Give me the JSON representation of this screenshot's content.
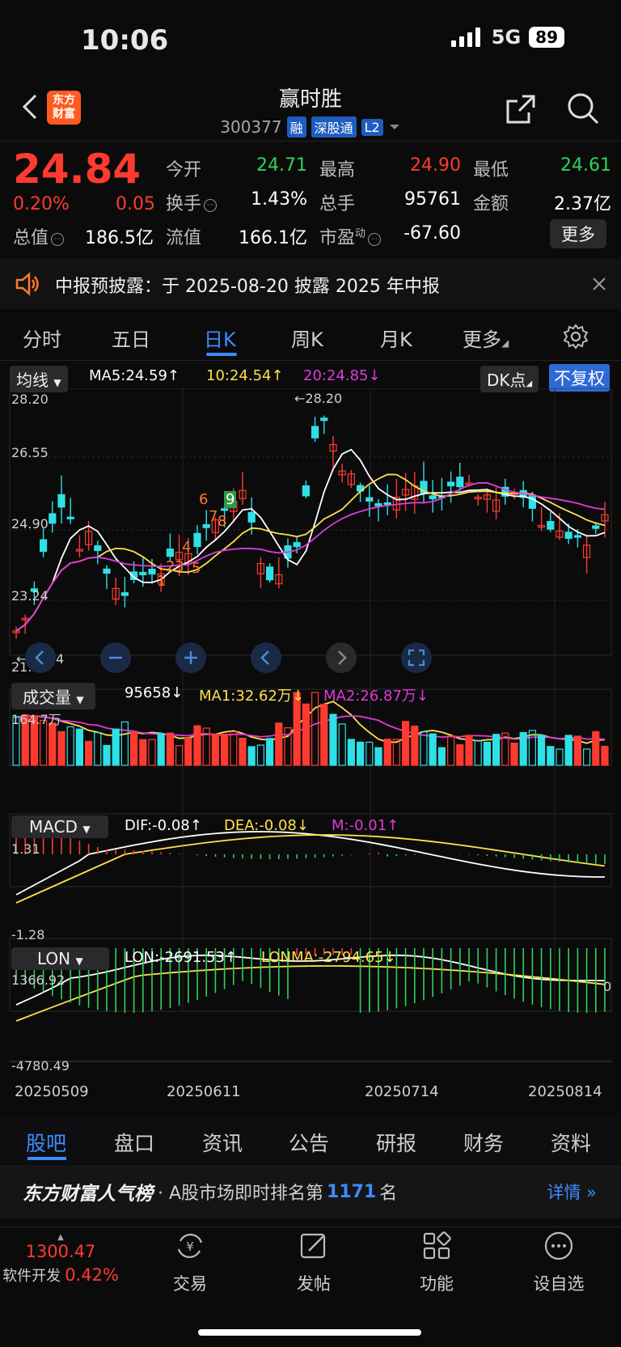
{
  "status": {
    "time": "10:06",
    "network": "5G",
    "battery": "89"
  },
  "header": {
    "brand_line1": "东方",
    "brand_line2": "财富",
    "title": "赢时胜",
    "code": "300377",
    "tags": [
      "融",
      "深股通",
      "L2"
    ]
  },
  "quote": {
    "price": "24.84",
    "chg_pct": "0.20%",
    "chg_val": "0.05",
    "rows": [
      [
        {
          "label": "今开",
          "value": "24.71",
          "color": "green"
        },
        {
          "label": "最高",
          "value": "24.90",
          "color": "red"
        },
        {
          "label": "最低",
          "value": "24.61",
          "color": "green"
        }
      ],
      [
        {
          "label": "换手",
          "value": "1.43%",
          "color": "white"
        },
        {
          "label": "总手",
          "value": "95761",
          "color": "white"
        },
        {
          "label": "金额",
          "value": "2.37亿",
          "color": "white"
        }
      ],
      [
        {
          "label": "总值",
          "value": "186.5亿"
        },
        {
          "label": "流值",
          "value": "166.1亿"
        },
        {
          "label": "市盈",
          "sup": "动",
          "value": "-67.60"
        }
      ]
    ],
    "more": "更多"
  },
  "notice": {
    "text": "中报预披露：于 2025-08-20 披露 2025 年中报"
  },
  "tabs": [
    "分时",
    "五日",
    "日K",
    "周K",
    "月K",
    "更多"
  ],
  "active_tab": "日K",
  "ma_bar": {
    "selector": "均线",
    "ma5": "MA5:24.59",
    "ma10": "10:24.54",
    "ma20": "20:24.85",
    "dk": "DK点",
    "fq": "不复权"
  },
  "kline": {
    "y_labels": [
      "28.20",
      "26.55",
      "24.90",
      "23.24",
      "21.59"
    ],
    "high_mark": "←28.20",
    "low_mark": "←21.94",
    "signals": [
      "1",
      "2",
      "3",
      "4",
      "5",
      "6",
      "7",
      "8",
      "9"
    ]
  },
  "volume_bar": {
    "selector": "成交量",
    "vol": "95658",
    "ma1": "MA1:32.62万",
    "ma2": "MA2:26.87万",
    "max_label": "164.7万"
  },
  "macd_bar": {
    "selector": "MACD",
    "dif": "DIF:-0.08",
    "dea": "DEA:-0.08",
    "m": "M:-0.01",
    "top": "1.31",
    "bottom": "-1.28"
  },
  "lon_bar": {
    "selector": "LON",
    "lon": "LON:-2691.53",
    "lonma": "LONMA:-2794.65",
    "top": "1366.92",
    "bottom": "-4780.49",
    "zero": "0"
  },
  "dates": [
    "20250509",
    "20250611",
    "20250714",
    "20250814"
  ],
  "bottom_tabs": [
    "股吧",
    "盘口",
    "资讯",
    "公告",
    "研报",
    "财务",
    "资料"
  ],
  "active_bottom_tab": "股吧",
  "rank": {
    "brand": "东方财富人气榜",
    "text": "· A股市场即时排名第",
    "num": "1171",
    "suffix": "名",
    "detail": "详情"
  },
  "index": {
    "value": "1300.47",
    "name": "软件开发",
    "pct": "0.42%"
  },
  "nav": [
    "交易",
    "发帖",
    "功能",
    "设自选"
  ],
  "colors": {
    "up": "#ff3b30",
    "down": "#2fe0e6",
    "ma5": "#ffffff",
    "ma10": "#ffe14a",
    "ma20": "#e03ad9",
    "accent": "#3d8bff"
  }
}
